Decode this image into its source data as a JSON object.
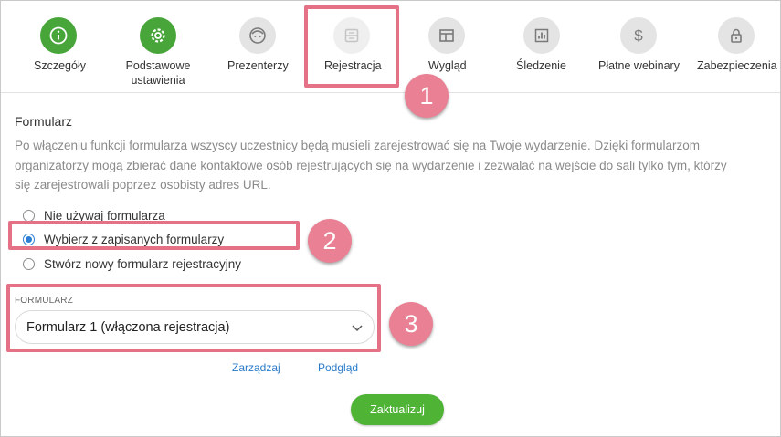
{
  "tabs": [
    {
      "label": "Szczegóły",
      "icon": "info-icon"
    },
    {
      "label": "Podstawowe ustawienia",
      "icon": "gear-icon"
    },
    {
      "label": "Prezenterzy",
      "icon": "face-icon"
    },
    {
      "label": "Rejestracja",
      "icon": "registration-form-icon"
    },
    {
      "label": "Wygląd",
      "icon": "layout-icon"
    },
    {
      "label": "Śledzenie",
      "icon": "bar-chart-icon"
    },
    {
      "label": "Płatne webinary",
      "icon": "dollar-icon"
    },
    {
      "label": "Zabezpieczenia",
      "icon": "lock-icon"
    }
  ],
  "section": {
    "title": "Formularz",
    "description": "Po włączeniu funkcji formularza wszyscy uczestnicy będą musieli zarejestrować się na Twoje wydarzenie. Dzięki formularzom organizatorzy mogą zbierać dane kontaktowe osób rejestrujących się na wydarzenie i zezwalać na wejście do sali tylko tym, którzy się zarejestrowali poprzez osobisty adres URL."
  },
  "options": [
    {
      "label": "Nie używaj formularza",
      "selected": false
    },
    {
      "label": "Wybierz z zapisanych formularzy",
      "selected": true
    },
    {
      "label": "Stwórz nowy formularz rejestracyjny",
      "selected": false
    }
  ],
  "form_select": {
    "label": "FORMULARZ",
    "value": "Formularz 1 (włączona rejestracja)"
  },
  "links": {
    "manage": "Zarządzaj",
    "preview": "Podgląd"
  },
  "update_button": "Zaktualizuj",
  "annotations": [
    "1",
    "2",
    "3"
  ],
  "colors": {
    "green": "#47a53a",
    "highlight": "#e57186",
    "link": "#2a7ac9",
    "button": "#4fb335"
  }
}
